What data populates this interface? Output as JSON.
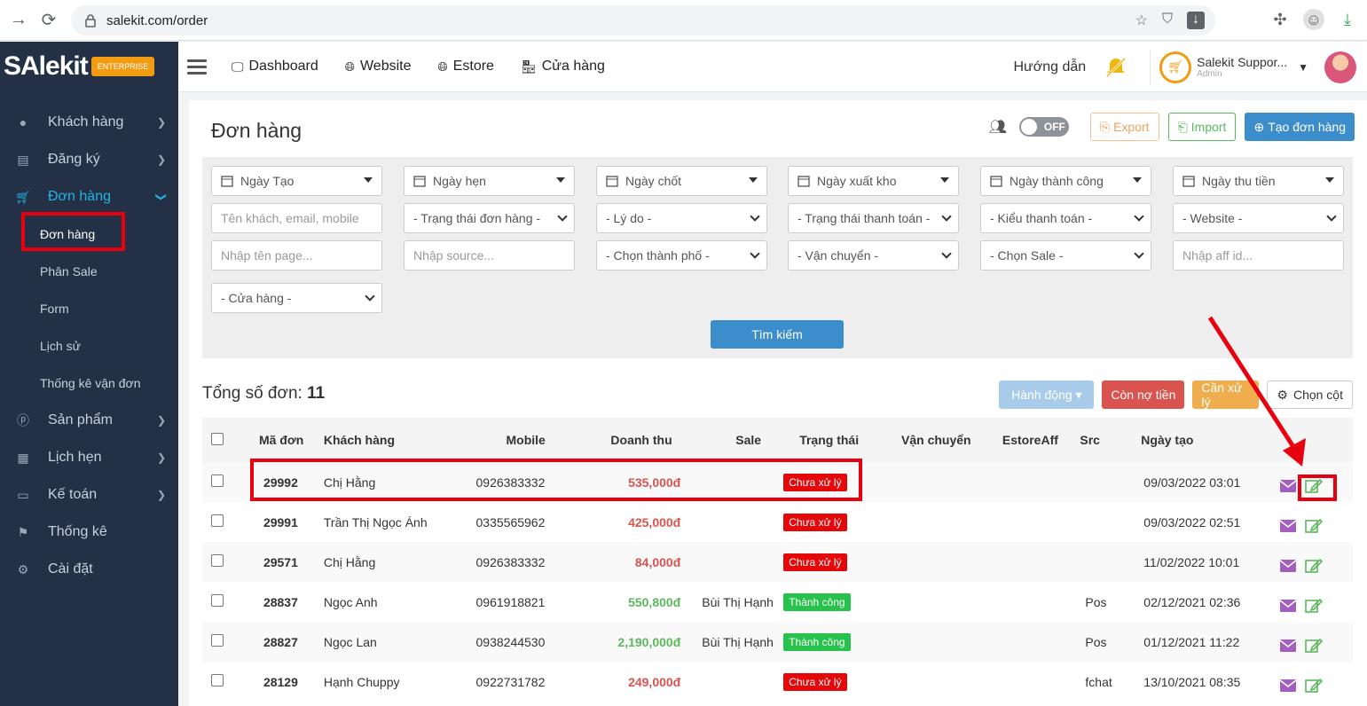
{
  "browser": {
    "url": "salekit.com/order"
  },
  "brand": {
    "name": "SAlekit",
    "badge": "ENTERPRISE"
  },
  "sidebar": {
    "items": [
      {
        "label": "Khách hàng",
        "icon": "user-icon",
        "chevron": true
      },
      {
        "label": "Đăng ký",
        "icon": "list-icon",
        "chevron": true
      },
      {
        "label": "Đơn hàng",
        "icon": "cart-icon",
        "chevron": true,
        "active": true
      },
      {
        "label": "Sản phẩm",
        "icon": "product-icon",
        "chevron": true
      },
      {
        "label": "Lịch hẹn",
        "icon": "calendar-icon",
        "chevron": true
      },
      {
        "label": "Kế toán",
        "icon": "credit-card-icon",
        "chevron": true
      },
      {
        "label": "Thống kê",
        "icon": "flag-icon",
        "chevron": false
      },
      {
        "label": "Cài đặt",
        "icon": "gear-icon",
        "chevron": false
      }
    ],
    "subitems": [
      "Đơn hàng",
      "Phân Sale",
      "Form",
      "Lịch sử",
      "Thống kê vận đơn"
    ]
  },
  "topbar": {
    "nav": [
      {
        "label": "Dashboard",
        "icon": "monitor-icon"
      },
      {
        "label": "Website",
        "icon": "globe-icon"
      },
      {
        "label": "Estore",
        "icon": "globe-icon"
      },
      {
        "label": "Cửa hàng",
        "icon": "store-icon"
      }
    ],
    "guide": "Hướng dẫn",
    "user_name": "Salekit Suppor...",
    "user_role": "Admin"
  },
  "page": {
    "title": "Đơn hàng",
    "toggle_label": "OFF",
    "export_label": "Export",
    "import_label": "Import",
    "create_label": "Tạo đơn hàng"
  },
  "filters": {
    "date_filters": [
      "Ngày Tạo",
      "Ngày hẹn",
      "Ngày chốt",
      "Ngày xuất kho",
      "Ngày thành công",
      "Ngày thu tiền"
    ],
    "customer_placeholder": "Tên khách, email, mobile, m",
    "order_status": "- Trạng thái đơn hàng -",
    "reason": "- Lý do -",
    "payment_status": "- Trạng thái thanh toán -",
    "payment_type": "- Kiểu thanh toán -",
    "website": "- Website -",
    "page_placeholder": "Nhập tên page...",
    "source_placeholder": "Nhập source...",
    "city": "- Chọn thành phố -",
    "shipping": "- Vận chuyển -",
    "sale": "- Chọn Sale -",
    "aff_placeholder": "Nhập aff id...",
    "store": "- Cửa hàng -",
    "search_label": "Tìm kiếm"
  },
  "list": {
    "total_label": "Tổng số đơn:",
    "total_value": "11",
    "action_label": "Hành động ▾",
    "debt_label": "Còn nợ tiền",
    "process_label": "Cần xử lý",
    "columns_label": "Chọn cột"
  },
  "table": {
    "headers": [
      "Mã đơn",
      "Khách hàng",
      "Mobile",
      "Doanh thu",
      "Sale",
      "Trạng thái",
      "Vận chuyển",
      "Estore",
      "Aff",
      "Src",
      "Ngày tạo"
    ],
    "rows": [
      {
        "code": "29992",
        "customer": "Chị Hằng",
        "mobile": "0926383332",
        "revenue": "535,000đ",
        "rev_color": "#d9534f",
        "sale": "",
        "status": "Chưa xử lý",
        "status_color": "#e4080a",
        "src": "",
        "created": "09/03/2022 03:01"
      },
      {
        "code": "29991",
        "customer": "Trần Thị Ngọc Ánh",
        "mobile": "0335565962",
        "revenue": "425,000đ",
        "rev_color": "#d9534f",
        "sale": "",
        "status": "Chưa xử lý",
        "status_color": "#e4080a",
        "src": "",
        "created": "09/03/2022 02:51"
      },
      {
        "code": "29571",
        "customer": "Chị Hằng",
        "mobile": "0926383332",
        "revenue": "84,000đ",
        "rev_color": "#d9534f",
        "sale": "",
        "status": "Chưa xử lý",
        "status_color": "#e4080a",
        "src": "",
        "created": "11/02/2022 10:01"
      },
      {
        "code": "28837",
        "customer": "Ngọc Anh",
        "mobile": "0961918821",
        "revenue": "550,800đ",
        "rev_color": "#5cb85c",
        "sale": "Bùi Thị Hạnh",
        "status": "Thành công",
        "status_color": "#27c24c",
        "src": "Pos",
        "created": "02/12/2021 02:36"
      },
      {
        "code": "28827",
        "customer": "Ngọc Lan",
        "mobile": "0938244530",
        "revenue": "2,190,000đ",
        "rev_color": "#5cb85c",
        "sale": "Bùi Thị Hạnh",
        "status": "Thành công",
        "status_color": "#27c24c",
        "src": "Pos",
        "created": "01/12/2021 11:22"
      },
      {
        "code": "28129",
        "customer": "Hạnh Chuppy",
        "mobile": "0922731782",
        "revenue": "249,000đ",
        "rev_color": "#d9534f",
        "sale": "",
        "status": "Chưa xử lý",
        "status_color": "#e4080a",
        "src": "fchat",
        "created": "13/10/2021 08:35"
      }
    ]
  },
  "colors": {
    "sidebar": "#243046",
    "accent": "#3c8dcc",
    "highlight": "#e8000f"
  }
}
